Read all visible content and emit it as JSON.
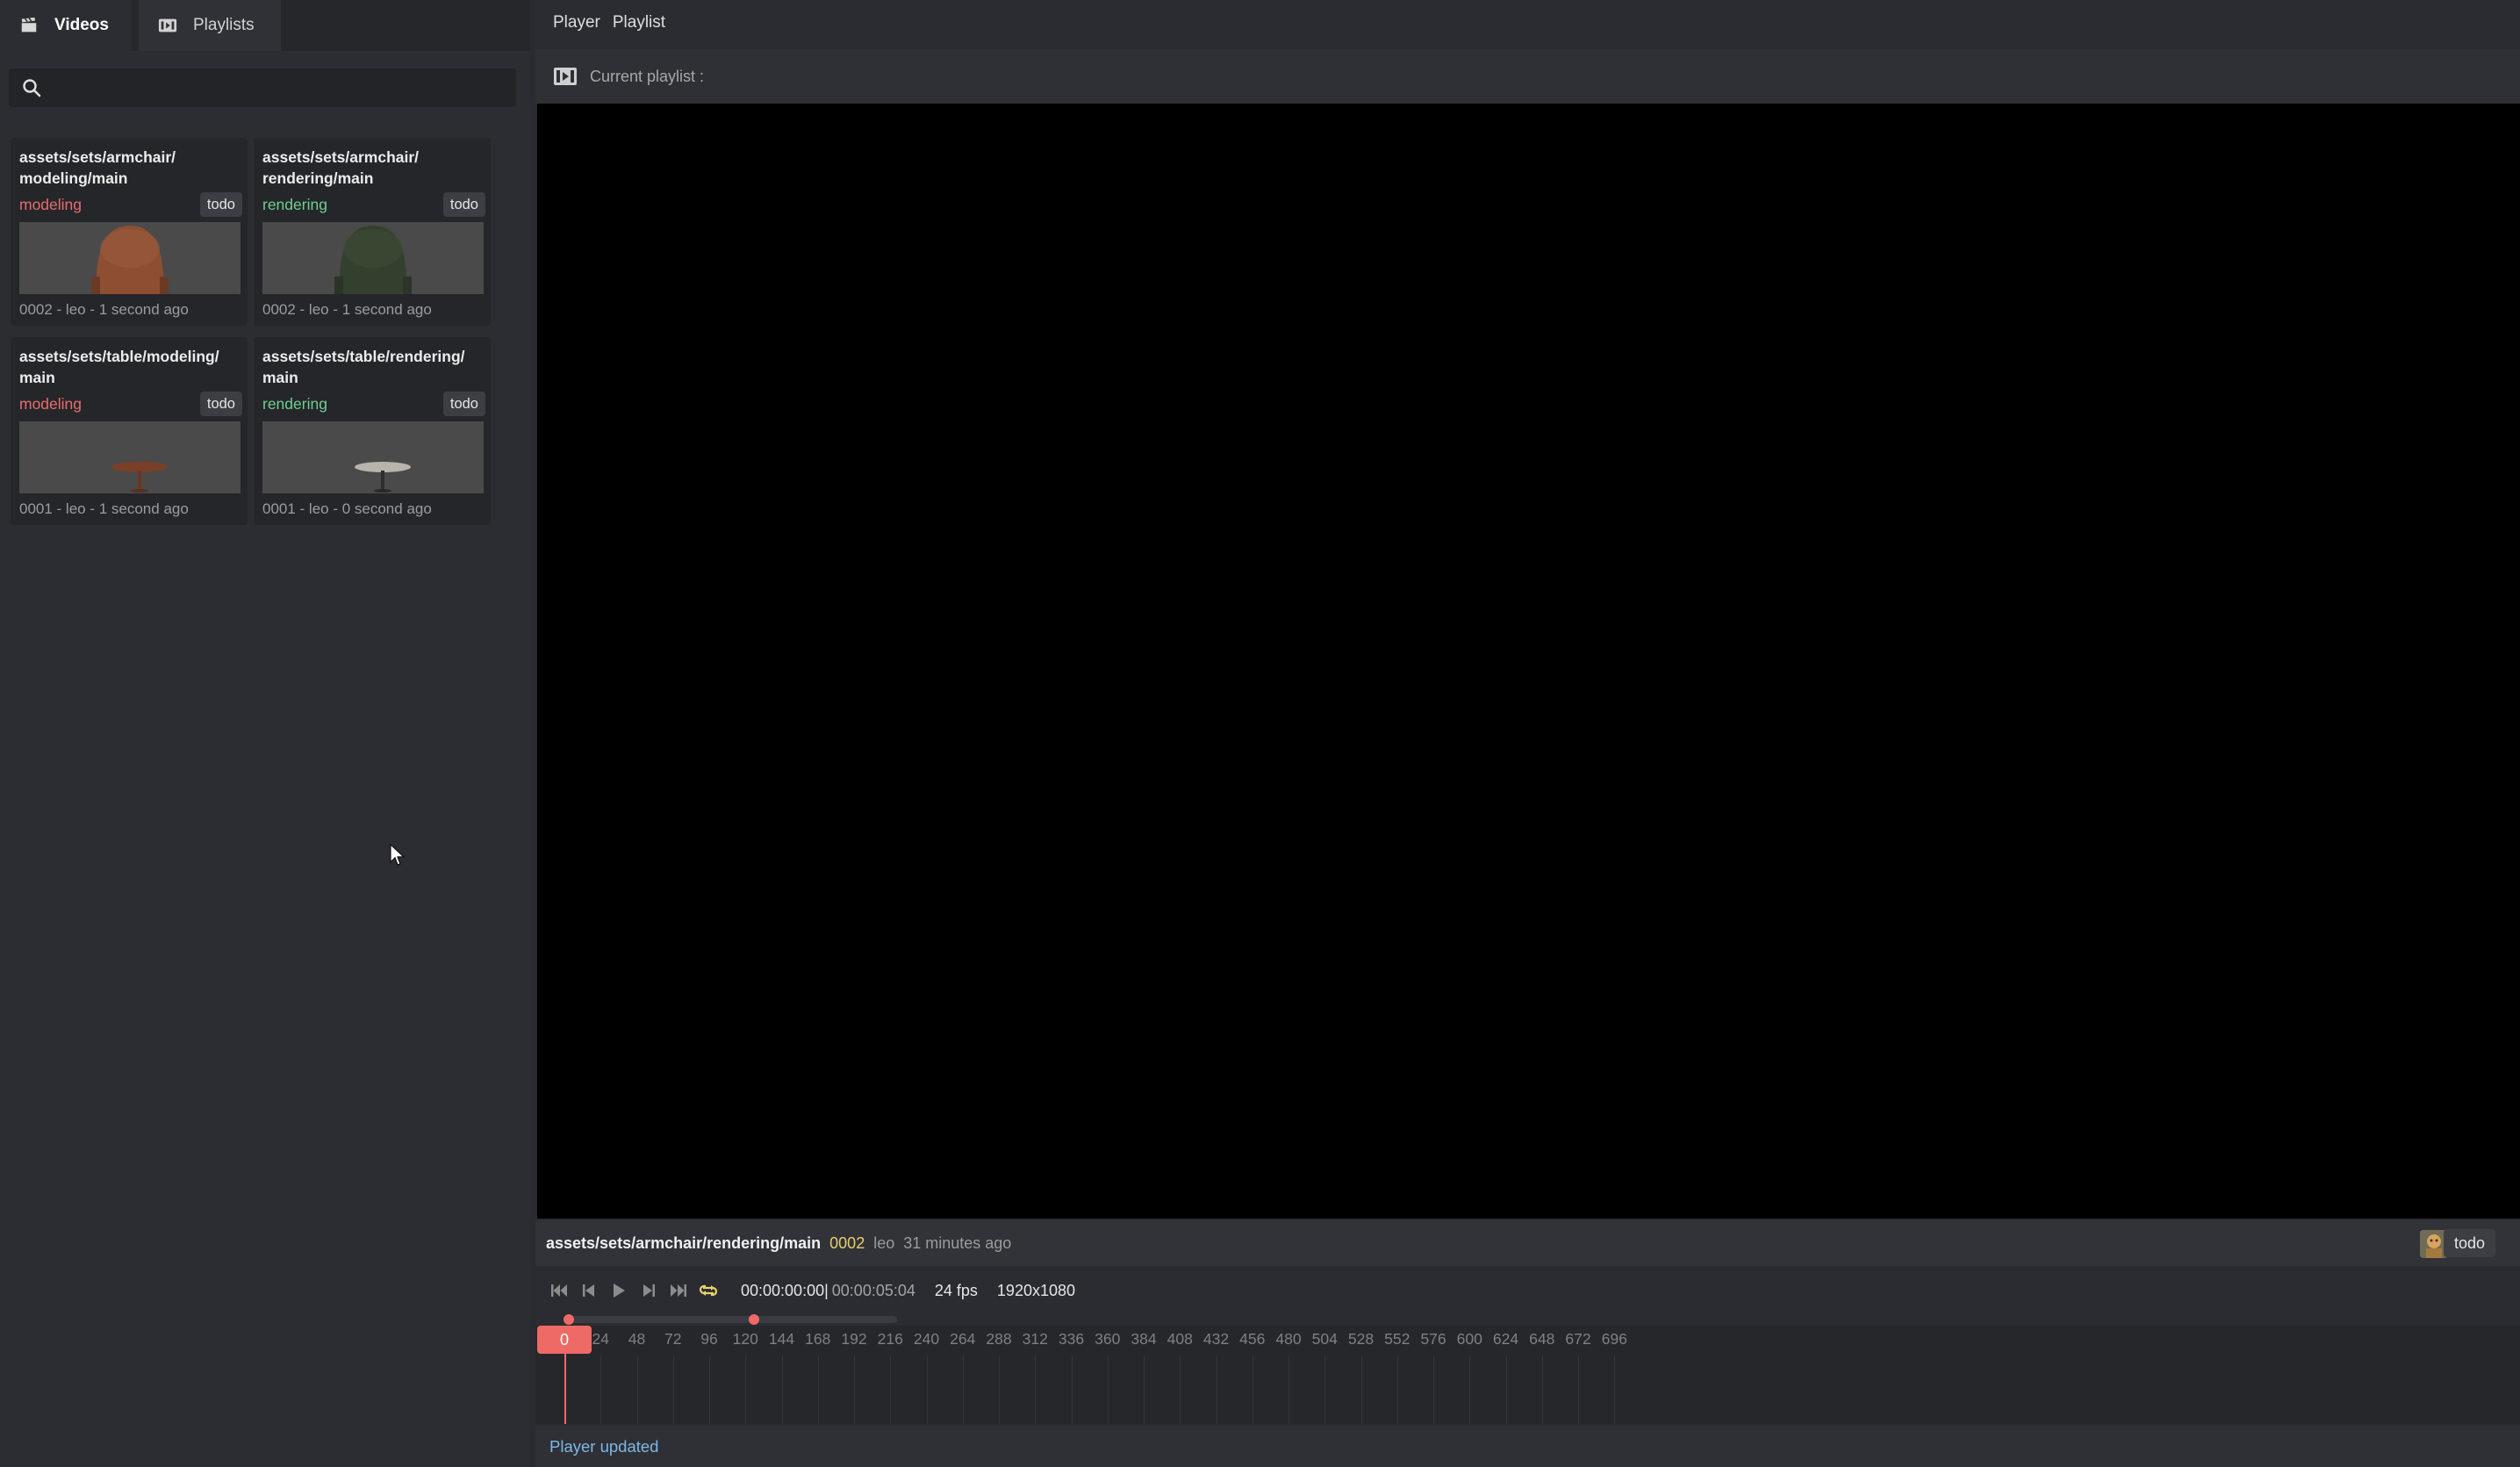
{
  "left": {
    "tabs": [
      {
        "label": "Videos",
        "icon": "clapperboard-icon"
      },
      {
        "label": "Playlists",
        "icon": "playlist-icon"
      }
    ],
    "search": {
      "placeholder": "",
      "value": ""
    },
    "cards": [
      {
        "title": "assets/sets/armchair/\nmodeling/main",
        "task": "modeling",
        "task_color": "#e86d6d",
        "status": "todo",
        "meta": "0002 - leo - 1 second ago",
        "thumb": "armchair-orange"
      },
      {
        "title": "assets/sets/armchair/\nrendering/main",
        "task": "rendering",
        "task_color": "#6fcf8f",
        "status": "todo",
        "meta": "0002 - leo - 1 second ago",
        "thumb": "armchair-green"
      },
      {
        "title": "assets/sets/table/modeling/\nmain",
        "task": "modeling",
        "task_color": "#e86d6d",
        "status": "todo",
        "meta": "0001 - leo - 1 second ago",
        "thumb": "table-brown"
      },
      {
        "title": "assets/sets/table/rendering/\nmain",
        "task": "rendering",
        "task_color": "#6fcf8f",
        "status": "todo",
        "meta": "0001 - leo - 0 second ago",
        "thumb": "table-white"
      }
    ]
  },
  "right": {
    "menu": [
      "Player",
      "Playlist"
    ],
    "current_playlist_label": "Current playlist :",
    "info": {
      "path": "assets/sets/armchair/rendering/main",
      "revision": "0002",
      "author": "leo",
      "ago": "31 minutes ago",
      "status": "todo"
    },
    "controls": {
      "timecode": "00:00:00:00",
      "separator": "|",
      "duration": "00:00:05:04",
      "fps": "24 fps",
      "resolution": "1920x1080"
    },
    "range": {
      "start": 0,
      "end": 124
    },
    "timeline": {
      "current_frame": "0",
      "ticks": [
        "24",
        "48",
        "72",
        "96",
        "120",
        "144",
        "168",
        "192",
        "216",
        "240",
        "264",
        "288",
        "312",
        "336",
        "360",
        "384",
        "408",
        "432",
        "456",
        "480",
        "504",
        "528",
        "552",
        "576",
        "600",
        "624",
        "648",
        "672",
        "696"
      ]
    },
    "status_message": "Player updated"
  },
  "colors": {
    "accent": "#ee6a66",
    "modeling": "#e86d6d",
    "rendering": "#6fcf8f",
    "revision": "#e6cf6d",
    "status_message": "#7cb8e8"
  }
}
